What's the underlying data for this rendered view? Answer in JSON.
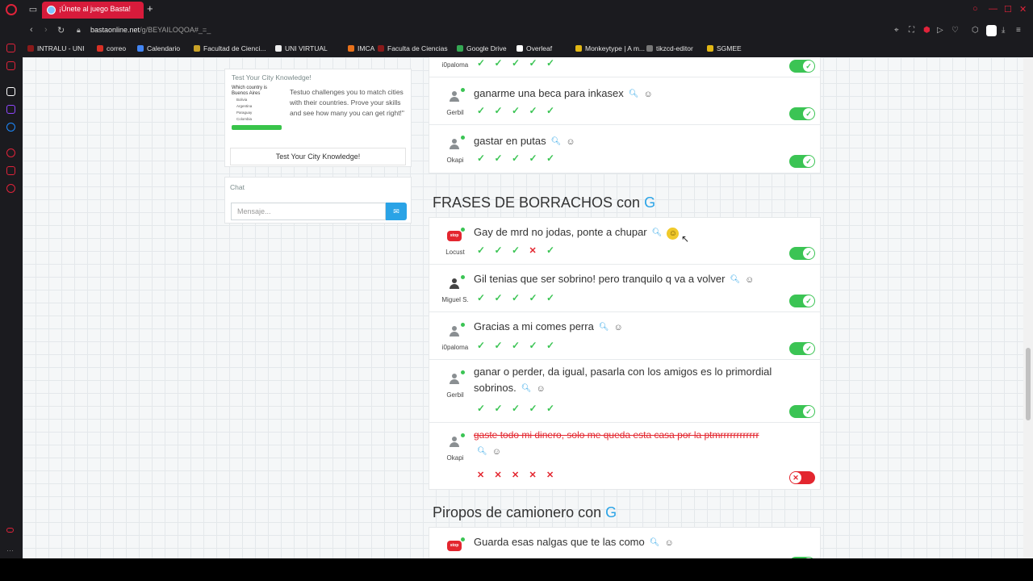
{
  "browser": {
    "tab_title": "¡Únete al juego Basta!",
    "url_main": "bastaonline.net",
    "url_rest": "/g/BEYAILOQOA#_=_",
    "colors": {
      "accent": "#d71b3b",
      "chrome": "#1b1b1f"
    }
  },
  "bookmarks": [
    {
      "label": "INTRALU - UNI",
      "color": "#8a1a1a"
    },
    {
      "label": "correo",
      "color": "#d93025"
    },
    {
      "label": "Calendario",
      "color": "#4285f4"
    },
    {
      "label": "Facultad de Cienci...",
      "color": "#c9a227"
    },
    {
      "label": "UNI VIRTUAL",
      "color": "#eeeeee"
    },
    {
      "label": "IMCA",
      "color": "#e8711a"
    },
    {
      "label": "Faculta de Ciencias",
      "color": "#8a1a1a"
    },
    {
      "label": "Google Drive",
      "color": "#34a853"
    },
    {
      "label": "Overleaf",
      "color": "#ffffff"
    },
    {
      "label": "Monkeytype | A m...",
      "color": "#e2b714"
    },
    {
      "label": "tikzcd-editor",
      "color": "#777777"
    },
    {
      "label": "SGMEE",
      "color": "#e2b714"
    }
  ],
  "ad": {
    "title": "Test Your City Knowledge!",
    "question": "Which country is Buenos Aires",
    "options": [
      "Bolivia",
      "Argentina",
      "Paraguay",
      "Colombia"
    ],
    "text": "Testuo challenges you to match cities with their countries. Prove your skills and see how many you can get right!\"",
    "button": "Test Your City Knowledge!"
  },
  "chat": {
    "title": "Chat",
    "placeholder": "Mensaje...",
    "send_icon": "message-icon"
  },
  "sections": [
    {
      "title": "",
      "letter": "",
      "rows": [
        {
          "player": "i0paloma",
          "avatar": "person",
          "phrase": "",
          "votes": [
            "ok",
            "ok",
            "ok",
            "ok",
            "ok"
          ],
          "valid": true
        },
        {
          "player": "Gerbil",
          "avatar": "person",
          "phrase": "ganarme una beca para inkasex",
          "votes": [
            "ok",
            "ok",
            "ok",
            "ok",
            "ok"
          ],
          "valid": true
        },
        {
          "player": "Okapi",
          "avatar": "person",
          "phrase": "gastar en putas",
          "votes": [
            "ok",
            "ok",
            "ok",
            "ok",
            "ok"
          ],
          "valid": true
        }
      ]
    },
    {
      "title": "FRASES DE BORRACHOS con",
      "letter": "G",
      "rows": [
        {
          "player": "Locust",
          "avatar": "stop",
          "phrase": "Gay de mrd no jodas, ponte a chupar",
          "votes": [
            "ok",
            "ok",
            "ok",
            "no",
            "ok"
          ],
          "valid": true,
          "highlight": true
        },
        {
          "player": "Miguel S.",
          "avatar": "person-dark",
          "phrase": "Gil tenias que ser sobrino! pero tranquilo q va a volver",
          "votes": [
            "ok",
            "ok",
            "ok",
            "ok",
            "ok"
          ],
          "valid": true
        },
        {
          "player": "i0paloma",
          "avatar": "person",
          "phrase": "Gracias a mi comes perra",
          "votes": [
            "ok",
            "ok",
            "ok",
            "ok",
            "ok"
          ],
          "valid": true
        },
        {
          "player": "Gerbil",
          "avatar": "person",
          "phrase": "ganar o perder, da igual, pasarla con los amigos es lo primordial sobrinos.",
          "votes": [
            "ok",
            "ok",
            "ok",
            "ok",
            "ok"
          ],
          "valid": true
        },
        {
          "player": "Okapi",
          "avatar": "person",
          "phrase": "gaste todo mi dinero, solo me queda esta casa por la ptmrrrrrrrrrrrr",
          "votes": [
            "no",
            "no",
            "no",
            "no",
            "no"
          ],
          "valid": false
        }
      ]
    },
    {
      "title": "Piropos de camionero con",
      "letter": "G",
      "rows": [
        {
          "player": "",
          "avatar": "stop",
          "phrase": "Guarda esas nalgas que te las como",
          "votes": [],
          "valid": true
        }
      ]
    }
  ],
  "stop_badge": "stop"
}
